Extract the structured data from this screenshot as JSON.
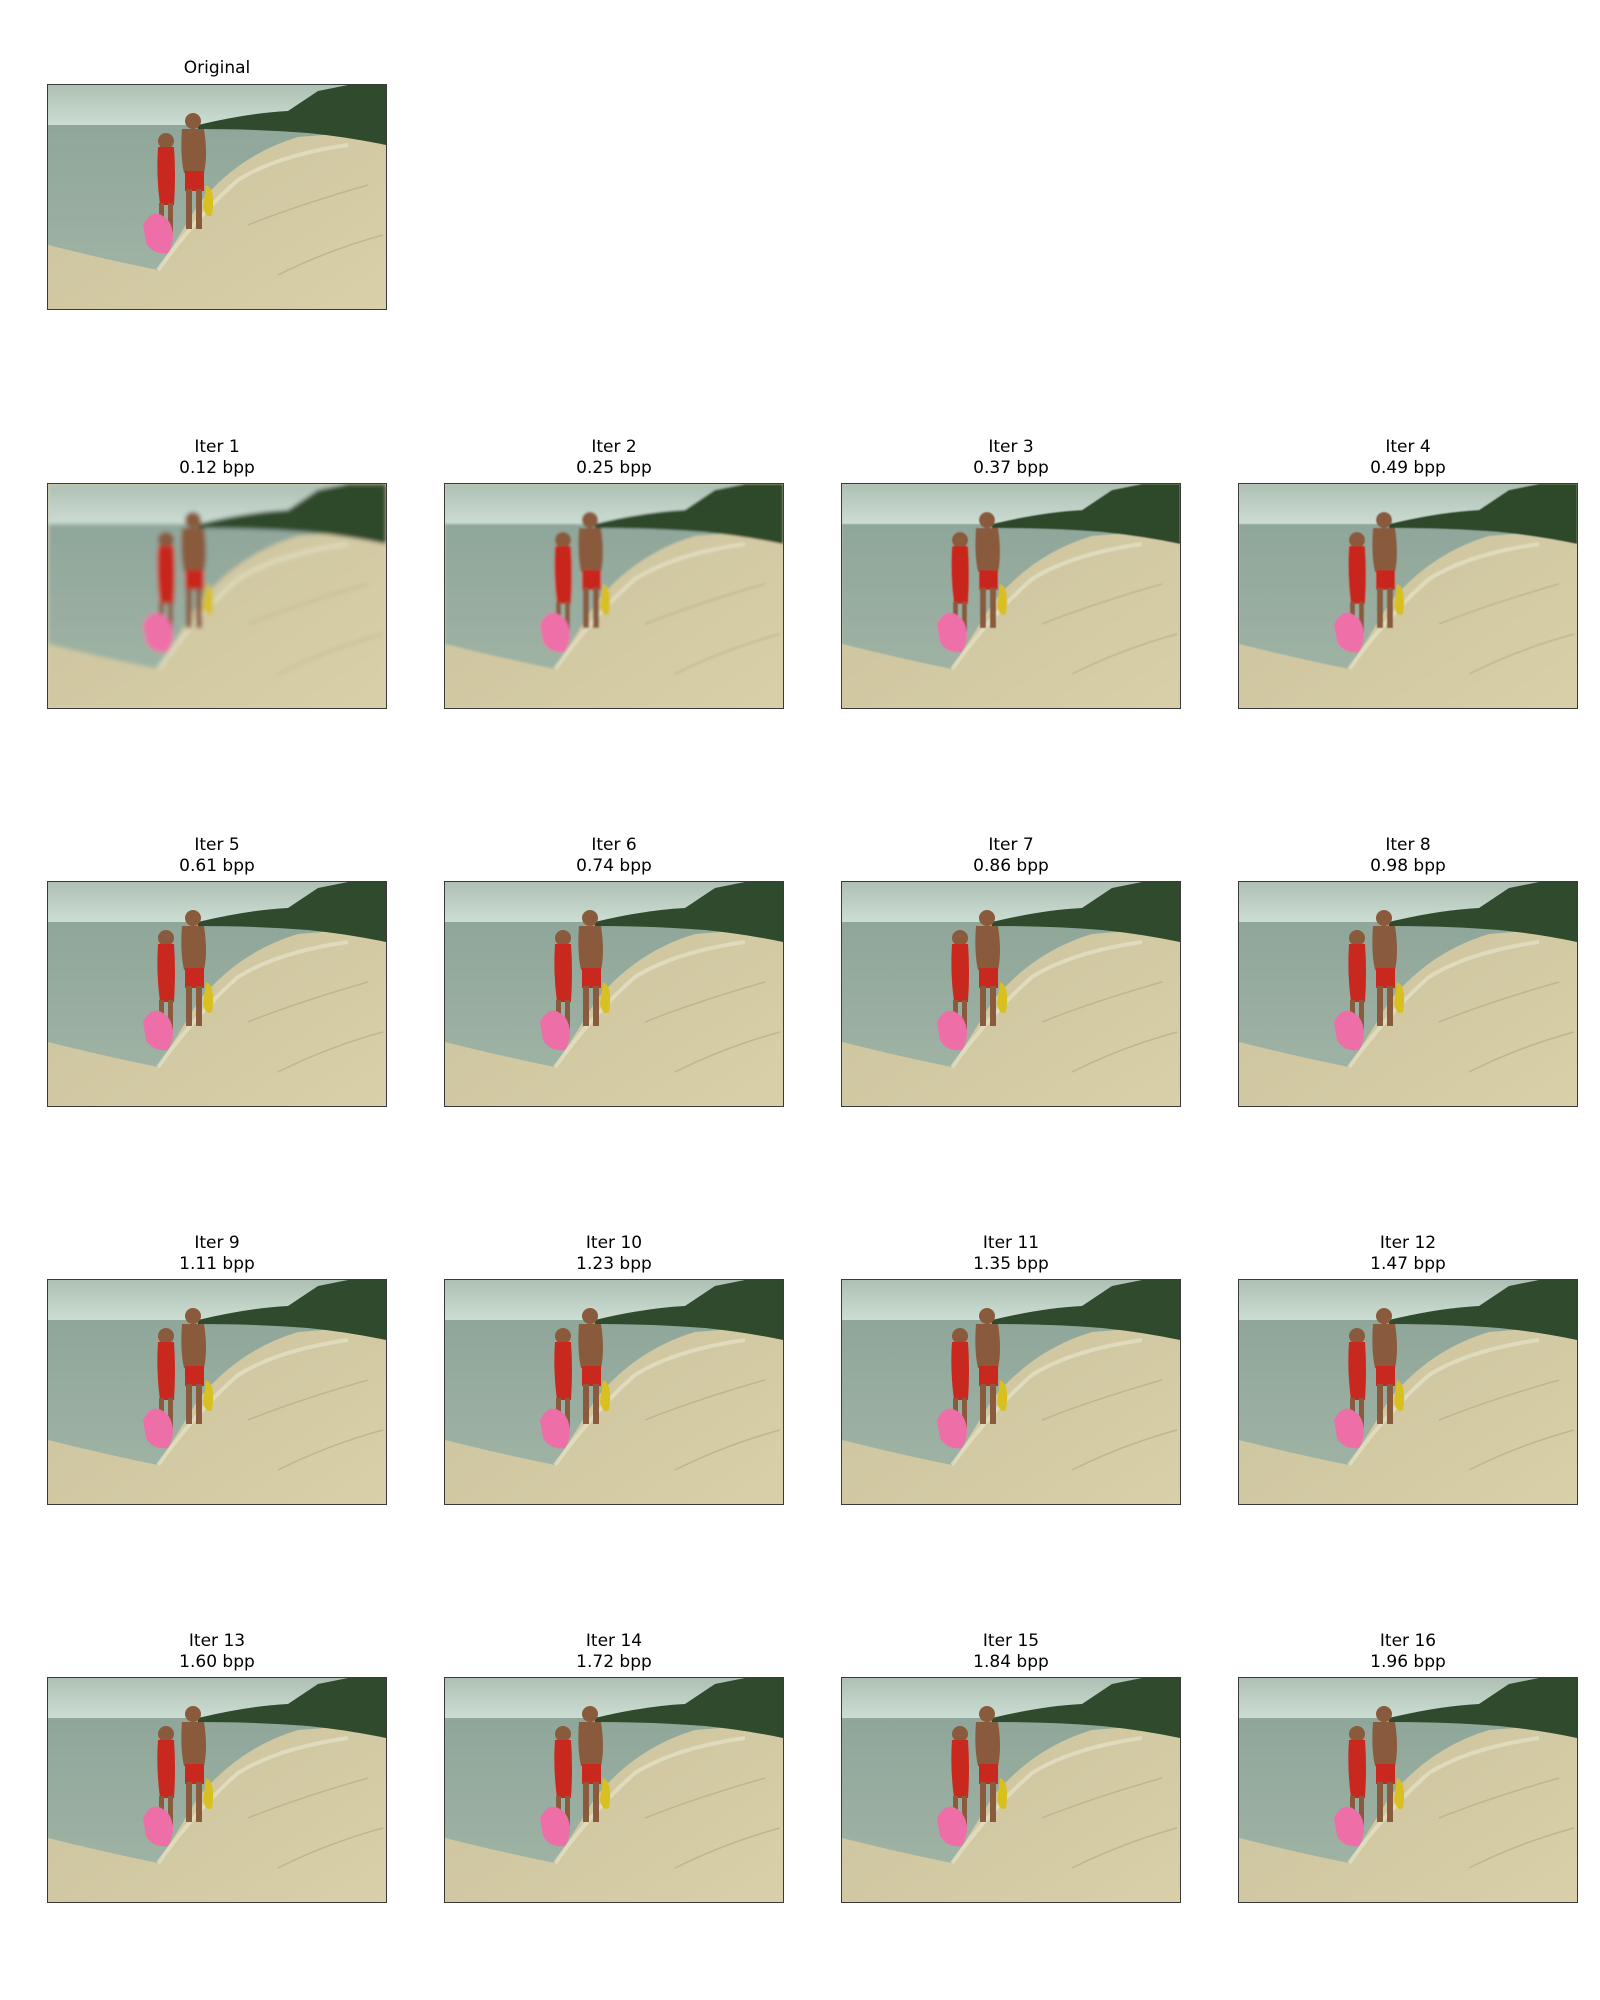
{
  "original": {
    "title": "Original"
  },
  "panels": [
    {
      "iter": "Iter 1",
      "bpp": "0.12 bpp"
    },
    {
      "iter": "Iter 2",
      "bpp": "0.25 bpp"
    },
    {
      "iter": "Iter 3",
      "bpp": "0.37 bpp"
    },
    {
      "iter": "Iter 4",
      "bpp": "0.49 bpp"
    },
    {
      "iter": "Iter 5",
      "bpp": "0.61 bpp"
    },
    {
      "iter": "Iter 6",
      "bpp": "0.74 bpp"
    },
    {
      "iter": "Iter 7",
      "bpp": "0.86 bpp"
    },
    {
      "iter": "Iter 8",
      "bpp": "0.98 bpp"
    },
    {
      "iter": "Iter 9",
      "bpp": "1.11 bpp"
    },
    {
      "iter": "Iter 10",
      "bpp": "1.23 bpp"
    },
    {
      "iter": "Iter 11",
      "bpp": "1.35 bpp"
    },
    {
      "iter": "Iter 12",
      "bpp": "1.47 bpp"
    },
    {
      "iter": "Iter 13",
      "bpp": "1.60 bpp"
    },
    {
      "iter": "Iter 14",
      "bpp": "1.72 bpp"
    },
    {
      "iter": "Iter 15",
      "bpp": "1.84 bpp"
    },
    {
      "iter": "Iter 16",
      "bpp": "1.96 bpp"
    }
  ],
  "colors": {
    "sky": "#cfe0d6",
    "sea": "#9fb3a4",
    "sand": "#d9cfa8",
    "trees": "#2f4a2c",
    "swimsuit": "#c8281e",
    "float": "#ee6fa8",
    "yellow_float": "#d8c020",
    "skin": "#8a5a3c",
    "frame_border": "#3a3a3a"
  }
}
